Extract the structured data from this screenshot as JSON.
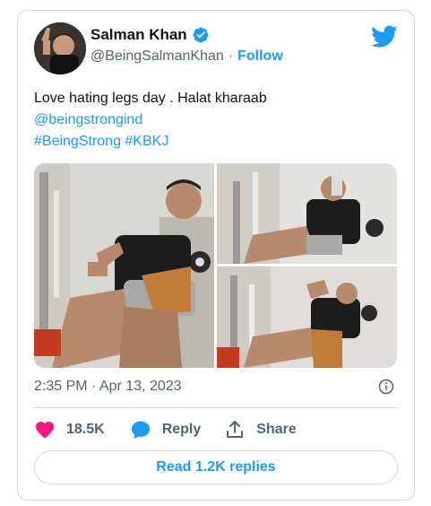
{
  "author": {
    "name": "Salman Khan",
    "handle": "@BeingSalmanKhan",
    "separator": "·",
    "follow_label": "Follow"
  },
  "tweet": {
    "text_line1": "Love hating legs day . Halat kharaab",
    "mention": "@beingstrongind",
    "hashtags": "#BeingStrong #KBKJ"
  },
  "media": [
    {
      "icon": "photo-gym-leg-press-wide"
    },
    {
      "icon": "photo-gym-drinking"
    },
    {
      "icon": "photo-gym-resting"
    }
  ],
  "meta": {
    "timestamp": "2:35 PM · Apr 13, 2023"
  },
  "actions": {
    "likes": "18.5K",
    "reply_label": "Reply",
    "share_label": "Share",
    "read_replies_label": "Read 1.2K replies"
  },
  "colors": {
    "accent": "#1d9bf0",
    "like": "#f91880",
    "text": "#0f1419",
    "muted": "#536471",
    "border": "#cfd9de"
  }
}
